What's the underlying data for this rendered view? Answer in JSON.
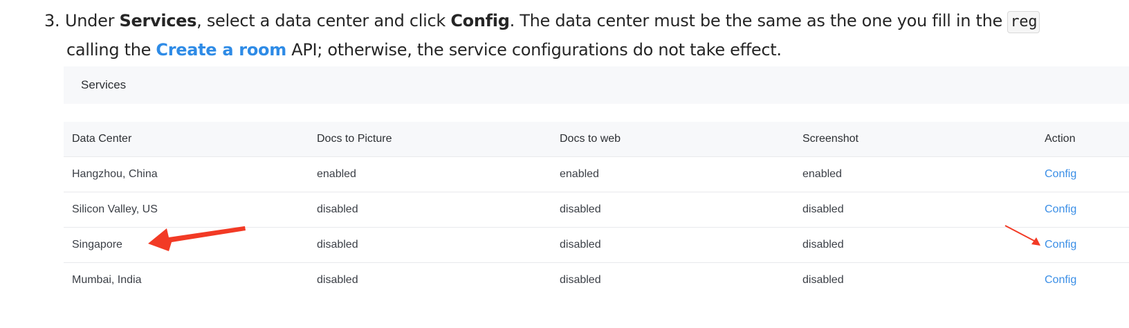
{
  "step": {
    "number": "3.",
    "t1": "Under ",
    "b1": "Services",
    "t2": ", select a data center and click ",
    "b2": "Config",
    "t3": ". The data center must be the same as the one you fill in the ",
    "code": "reg",
    "t4": "calling the ",
    "link": "Create a room",
    "t5": " API; otherwise, the service configurations do not take effect.",
    "link_color": "#2e8be6"
  },
  "services": {
    "title": "Services",
    "columns": [
      "Data Center",
      "Docs to Picture",
      "Docs to web",
      "Screenshot",
      "Action"
    ],
    "rows": [
      {
        "data_center": "Hangzhou, China",
        "docs_to_picture": "enabled",
        "docs_to_web": "enabled",
        "screenshot": "enabled",
        "action": "Config"
      },
      {
        "data_center": "Silicon Valley, US",
        "docs_to_picture": "disabled",
        "docs_to_web": "disabled",
        "screenshot": "disabled",
        "action": "Config"
      },
      {
        "data_center": "Singapore",
        "docs_to_picture": "disabled",
        "docs_to_web": "disabled",
        "screenshot": "disabled",
        "action": "Config"
      },
      {
        "data_center": "Mumbai, India",
        "docs_to_picture": "disabled",
        "docs_to_web": "disabled",
        "screenshot": "disabled",
        "action": "Config"
      }
    ],
    "action_color": "#3a8ee6",
    "annotation_color": "#f23a25"
  },
  "annotations": [
    {
      "icon": "red-arrow-icon",
      "points_to": "Singapore"
    },
    {
      "icon": "red-arrow-icon",
      "points_to": "Config"
    }
  ]
}
